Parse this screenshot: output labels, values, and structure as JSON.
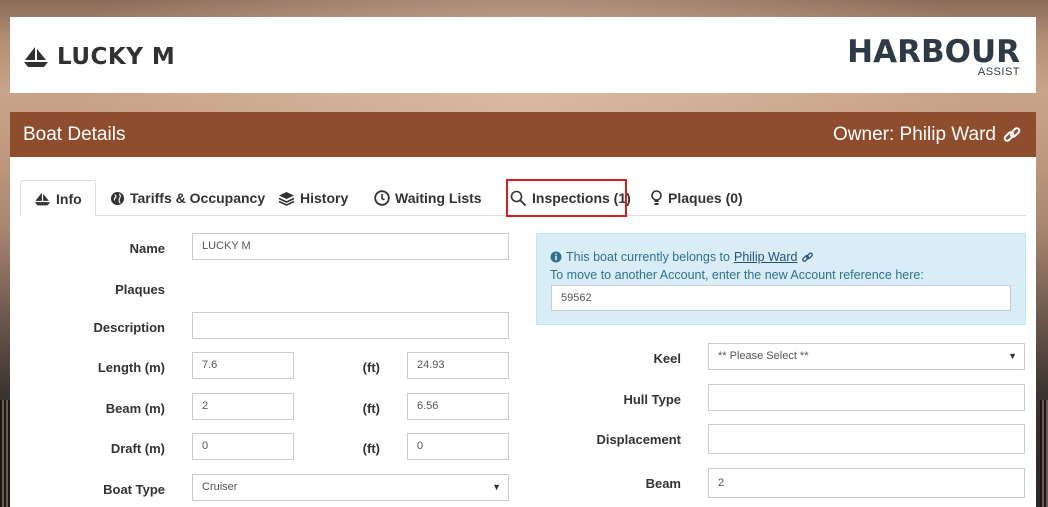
{
  "header": {
    "boat_name": "LUCKY M",
    "logo_main": "HARBOUR",
    "logo_sub": "ASSIST"
  },
  "panel": {
    "title": "Boat Details",
    "owner_label": "Owner: Philip Ward"
  },
  "tabs": [
    {
      "label": "Info",
      "icon": "sailboat-icon",
      "active": true
    },
    {
      "label": "Tariffs & Occupancy",
      "icon": "globe-icon"
    },
    {
      "label": "History",
      "icon": "layers-icon"
    },
    {
      "label": "Waiting Lists",
      "icon": "clock-icon"
    },
    {
      "label": "Inspections (1)",
      "icon": "search-icon",
      "highlighted": true
    },
    {
      "label": "Plaques (0)",
      "icon": "lightbulb-icon"
    }
  ],
  "form": {
    "name_label": "Name",
    "name_value": "LUCKY M",
    "plaques_label": "Plaques",
    "description_label": "Description",
    "description_value": "",
    "length_label": "Length (m)",
    "length_m": "7.6",
    "length_ft": "24.93",
    "beam_label": "Beam (m)",
    "beam_m": "2",
    "beam_ft": "6.56",
    "draft_label": "Draft (m)",
    "draft_m": "0",
    "draft_ft": "0",
    "ft_label": "(ft)",
    "boat_type_label": "Boat Type",
    "boat_type_value": "Cruiser"
  },
  "info_box": {
    "belongs_text": "This boat currently belongs to",
    "owner_name": "Philip Ward",
    "move_text": "To move to another Account, enter the new Account reference here:",
    "account_ref": "59562"
  },
  "right_form": {
    "keel_label": "Keel",
    "keel_value": "** Please Select **",
    "hull_type_label": "Hull Type",
    "hull_type_value": "",
    "displacement_label": "Displacement",
    "displacement_value": "",
    "beam_label": "Beam",
    "beam_value": "2"
  },
  "colors": {
    "panel_header": "#8e4e2e",
    "info_bg": "#d9edf7",
    "info_text": "#31708f",
    "highlight": "#d42020"
  }
}
